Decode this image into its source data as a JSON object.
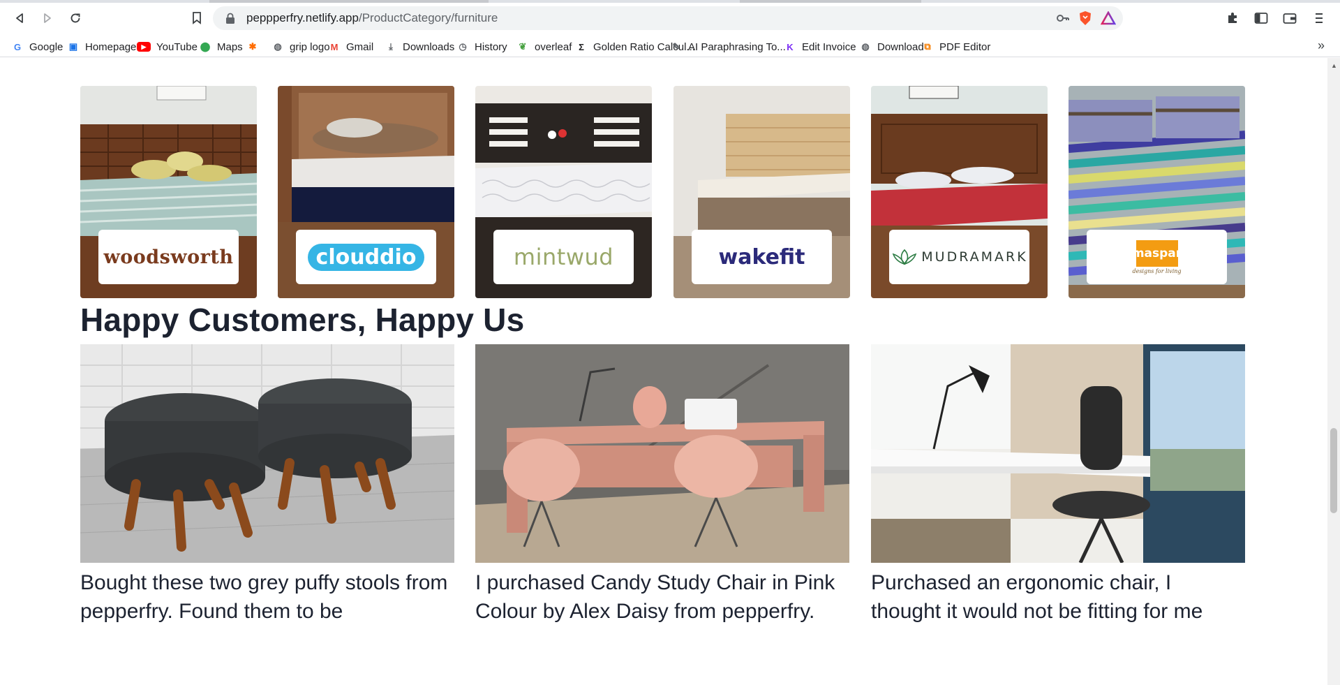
{
  "browser": {
    "url_host": "peppperfry.netlify.app",
    "url_path": "/ProductCategory/furniture",
    "bookmarks": [
      {
        "label": "Google",
        "icon": "google-icon",
        "color": "#4285f4"
      },
      {
        "label": "Homepage",
        "icon": "homepage-icon",
        "color": "#1a73e8"
      },
      {
        "label": "YouTube",
        "icon": "youtube-icon",
        "color": "#ff0000"
      },
      {
        "label": "Maps",
        "icon": "maps-icon",
        "color": "#34a853"
      },
      {
        "label": "",
        "icon": "custom-star-icon",
        "color": "#ff6d00"
      },
      {
        "label": "grip logo",
        "icon": "globe-icon",
        "color": "#5f6368"
      },
      {
        "label": "Gmail",
        "icon": "gmail-icon",
        "color": "#ea4335"
      },
      {
        "label": "Downloads",
        "icon": "download-icon",
        "color": "#5f6368"
      },
      {
        "label": "History",
        "icon": "history-icon",
        "color": "#5f6368"
      },
      {
        "label": "overleaf",
        "icon": "overleaf-icon",
        "color": "#47a141"
      },
      {
        "label": "Golden Ratio Calcul...",
        "icon": "sigma-icon",
        "color": "#202124"
      },
      {
        "label": "AI Paraphrasing To...",
        "icon": "quill-icon",
        "color": "#5f6368"
      },
      {
        "label": "Edit Invoice",
        "icon": "invoice-icon",
        "color": "#7b2cf5"
      },
      {
        "label": "Download",
        "icon": "globe-icon",
        "color": "#5f6368"
      },
      {
        "label": "PDF Editor",
        "icon": "pdf-icon",
        "color": "#f57c00"
      }
    ]
  },
  "brands": [
    {
      "name": "woodsworth",
      "color": "#7a3b1e"
    },
    {
      "name": "clouddio",
      "color": "#35b5e5"
    },
    {
      "name": "mintwud",
      "color": "#9aa86a"
    },
    {
      "name": "wakefit",
      "color": "#2b2a7a"
    },
    {
      "name": "MUDRAMARK",
      "color": "#2e3b33"
    },
    {
      "name": "maspar",
      "tagline": "designs for living",
      "color": "#f39c12"
    }
  ],
  "section": {
    "title": "Happy Customers, Happy Us"
  },
  "testimonials": [
    {
      "text": "Bought these two grey puffy stools from pepperfry. Found them to be"
    },
    {
      "text": "I purchased Candy Study Chair in Pink Colour by Alex Daisy from pepperfry."
    },
    {
      "text": "Purchased an ergonomic chair, I thought it would not be fitting for me"
    }
  ]
}
